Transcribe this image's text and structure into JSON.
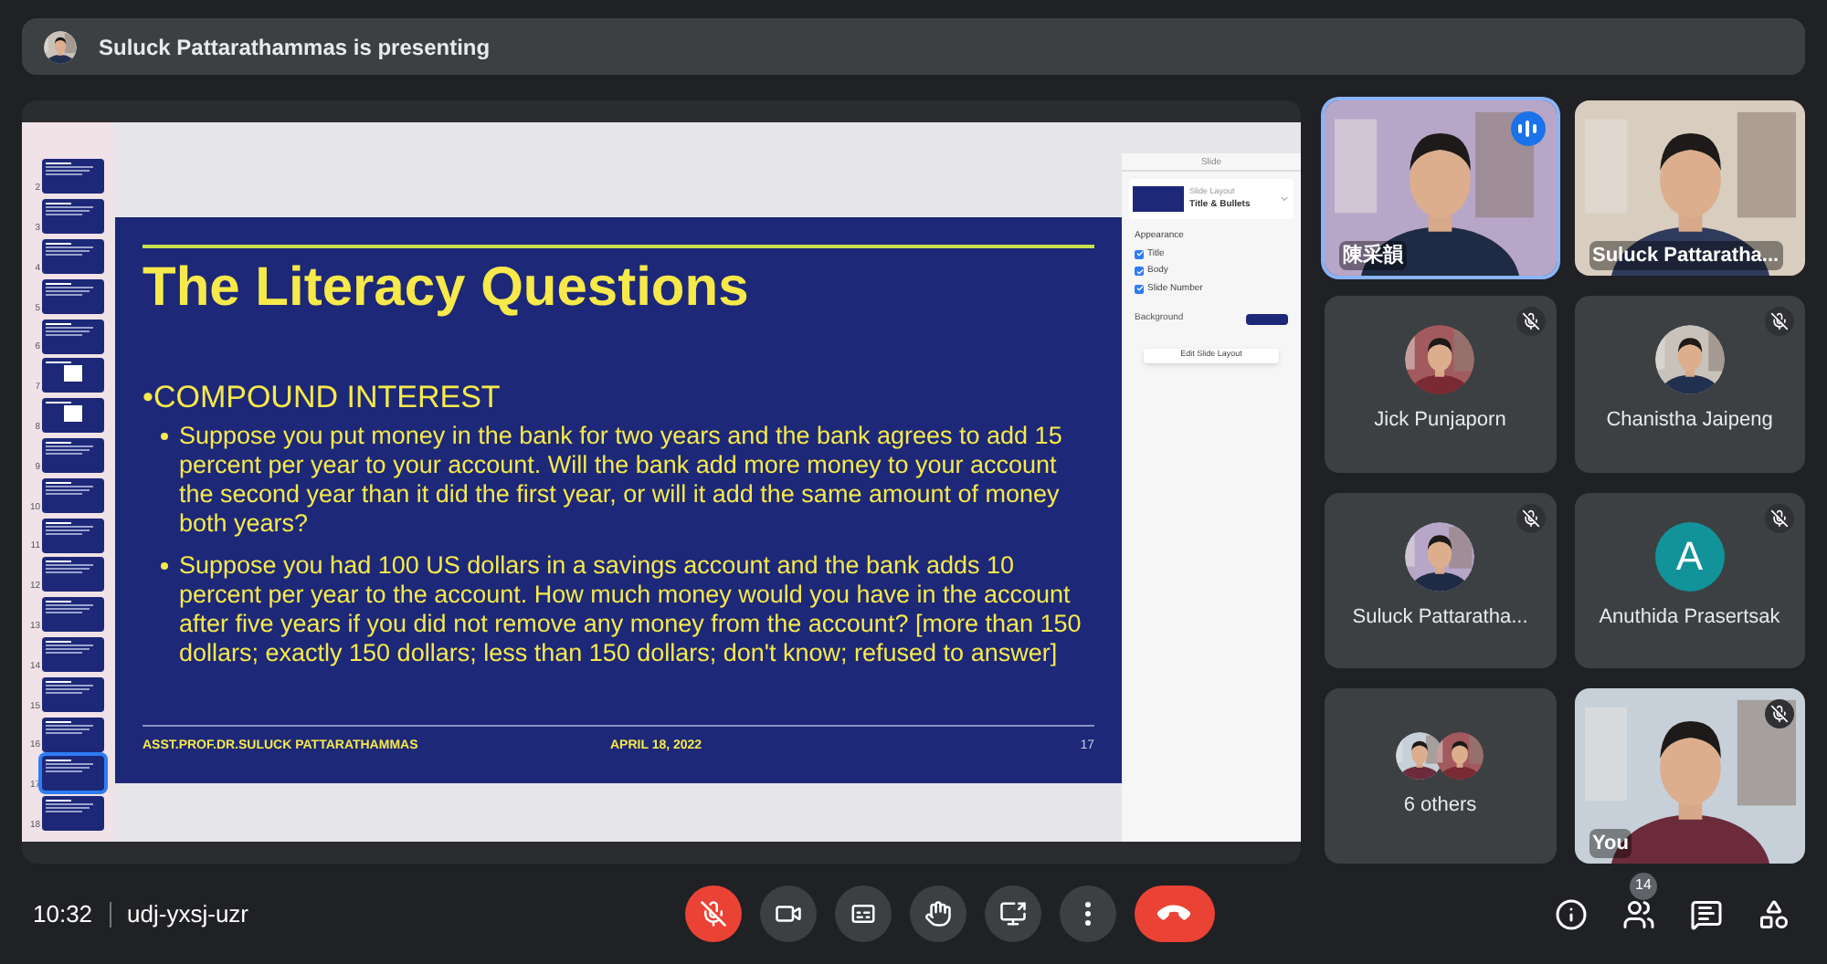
{
  "banner": {
    "text": "Suluck Pattarathammas is presenting"
  },
  "presentation": {
    "thumbnails": [
      {
        "number": "2",
        "kind": "text",
        "selected": false
      },
      {
        "number": "3",
        "kind": "text",
        "selected": false
      },
      {
        "number": "4",
        "kind": "text",
        "selected": false
      },
      {
        "number": "5",
        "kind": "text",
        "selected": false
      },
      {
        "number": "6",
        "kind": "text",
        "selected": false
      },
      {
        "number": "7",
        "selected": false
      },
      {
        "number": "8",
        "selected": false
      },
      {
        "number": "9",
        "kind": "text",
        "selected": false
      },
      {
        "number": "10",
        "kind": "text",
        "selected": false
      },
      {
        "number": "11",
        "kind": "text",
        "selected": false
      },
      {
        "number": "12",
        "kind": "text",
        "selected": false
      },
      {
        "number": "13",
        "kind": "text",
        "selected": false
      },
      {
        "number": "14",
        "kind": "text",
        "selected": false
      },
      {
        "number": "15",
        "kind": "text",
        "selected": false
      },
      {
        "number": "16",
        "kind": "text",
        "selected": false
      },
      {
        "number": "17",
        "kind": "text",
        "selected": true
      },
      {
        "number": "18",
        "kind": "text",
        "selected": false
      }
    ],
    "slide": {
      "title": "The Literacy Questions",
      "heading": "•COMPOUND INTEREST",
      "bullets": [
        "Suppose you put money in the bank for two years and the bank agrees to add 15 percent per year to your account. Will the bank add more money to your account the second year than it did the first year, or will it add the same amount of money both years?",
        "Suppose you had 100 US dollars in a savings account and the bank adds 10 percent per year to the account. How much money would you have in the account after five years if you did not remove any money from the account? [more than 150 dollars; exactly 150 dollars; less than 150 dollars; don't know; refused to answer]"
      ],
      "footer_author": "ASST.PROF.DR.SULUCK PATTARATHAMMAS",
      "footer_date": "APRIL 18, 2022",
      "footer_number": "17"
    },
    "inspector": {
      "header": "Slide",
      "layout_label": "Slide Layout",
      "layout_value": "Title & Bullets",
      "appearance_label": "Appearance",
      "options": [
        {
          "label": "Title",
          "checked": true
        },
        {
          "label": "Body",
          "checked": true
        },
        {
          "label": "Slide Number",
          "checked": true
        }
      ],
      "background_label": "Background",
      "edit_button": "Edit Slide Layout"
    }
  },
  "participants": [
    {
      "kind": "video",
      "name": "陳采韻",
      "speaking": true,
      "muted": false
    },
    {
      "kind": "video",
      "name": "Suluck Pattaratha...",
      "speaking": false,
      "muted": false
    },
    {
      "name": "Jick Punjaporn",
      "speaking": false,
      "muted": true
    },
    {
      "name": "Chanistha Jaipeng",
      "speaking": false,
      "muted": true
    },
    {
      "name": "Suluck Pattaratha...",
      "speaking": false,
      "muted": true
    },
    {
      "kind": "letter",
      "letter": "A",
      "color": "#12939a",
      "name": "Anuthida Prasertsak",
      "speaking": false,
      "muted": true
    },
    {
      "kind": "group",
      "name": "6 others",
      "speaking": false,
      "muted": false
    },
    {
      "kind": "video",
      "name": "You",
      "speaking": false,
      "muted": true
    }
  ],
  "toolbar": {
    "time": "10:32",
    "meeting_code": "udj-yxsj-uzr",
    "mic_on": false,
    "people_count": "14"
  }
}
